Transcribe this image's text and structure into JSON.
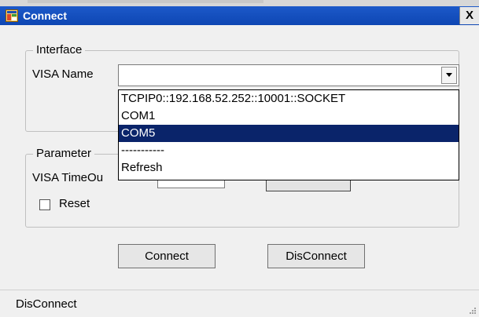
{
  "window": {
    "title": "Connect",
    "close_glyph": "X",
    "icon": "app-window-icon"
  },
  "interface": {
    "legend": "Interface",
    "visa_name_label": "VISA Name",
    "visa_name_value": "",
    "options": [
      "TCPIP0::192.168.52.252::10001::SOCKET",
      "COM1",
      "COM5",
      "-----------",
      "Refresh"
    ],
    "selected_option": "COM5"
  },
  "parameter": {
    "legend": "Parameter",
    "timeout_label": "VISA TimeOu",
    "reset_label": "Reset",
    "reset_checked": false
  },
  "buttons": {
    "connect": "Connect",
    "disconnect": "DisConnect"
  },
  "status": {
    "text": "DisConnect"
  },
  "colors": {
    "titlebar": "#1c59c9",
    "selection": "#0a246a"
  }
}
